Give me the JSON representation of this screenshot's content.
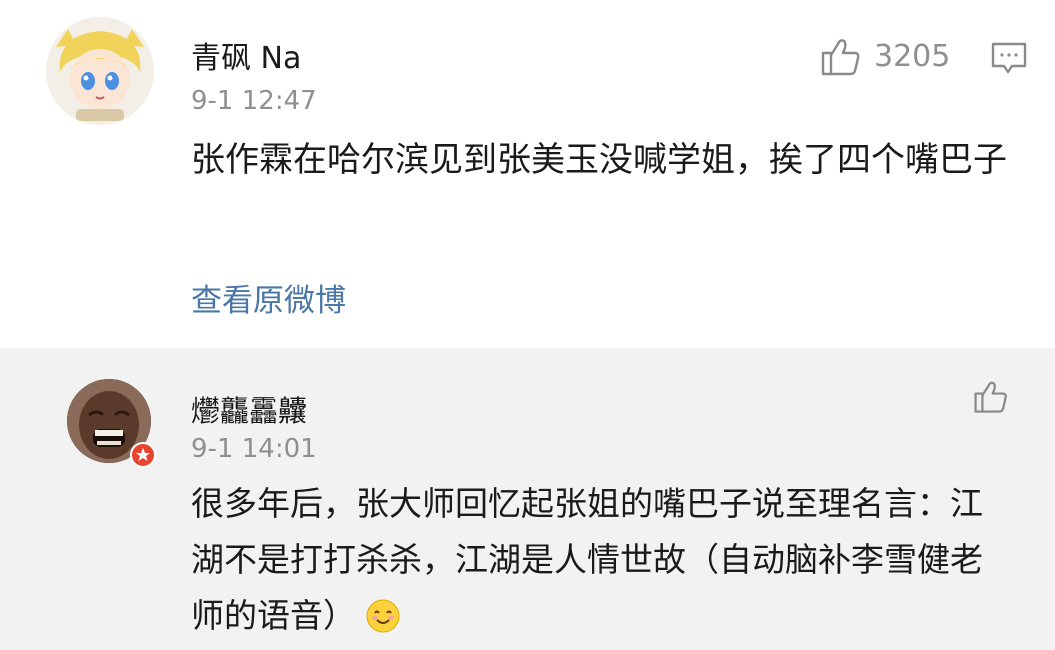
{
  "post": {
    "user_name": "青砜 Na",
    "timestamp": "9-1 12:47",
    "content": "张作霖在哈尔滨见到张美玉没喊学姐，挨了四个嘴巴子",
    "like_count": "3205",
    "view_original_label": "查看原微博",
    "icons": {
      "like": "thumbs-up-icon",
      "comment": "comment-icon",
      "avatar": "anime-avatar"
    }
  },
  "reply": {
    "user_name": "爩龘靐齉",
    "timestamp": "9-1 14:01",
    "content": "很多年后，张大师回忆起张姐的嘴巴子说至理名言：江湖不是打打杀杀，江湖是人情世故（自动脑补李雪健老师的语音）",
    "emoji": "smiling-face-emoji",
    "icons": {
      "like": "thumbs-up-icon",
      "badge": "star-badge-icon"
    }
  },
  "colors": {
    "post_background": "#ffffff",
    "reply_background": "#f2f2f2",
    "link": "#4a77a8",
    "meta_text": "#8f8f8f",
    "badge": "#e8432f"
  }
}
